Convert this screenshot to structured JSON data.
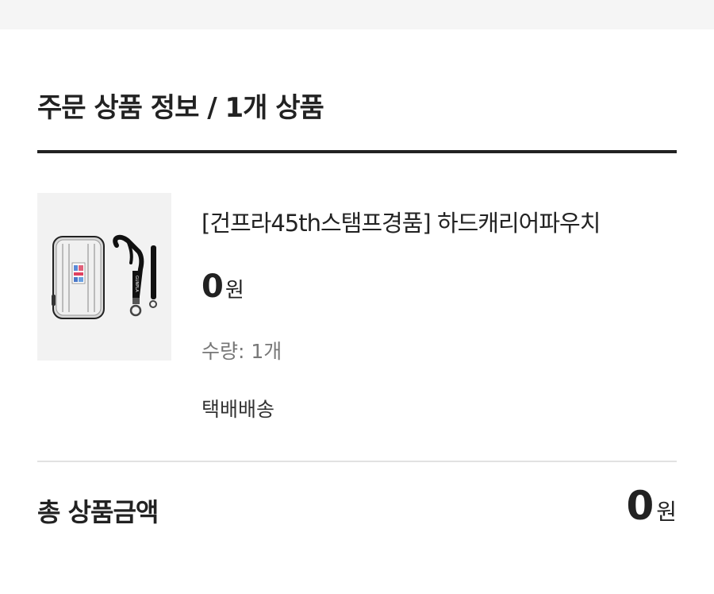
{
  "order_section": {
    "title": "주문 상품 정보 / 1개 상품"
  },
  "product": {
    "image_icon": "hard-carrier-pouch-image",
    "name": "[건프라45th스탬프경품] 하드캐리어파우치",
    "price_value": "0",
    "price_unit": "원",
    "quantity": "수량: 1개",
    "shipping": "택배배송"
  },
  "summary": {
    "total_label": "총 상품금액",
    "total_value": "0",
    "total_unit": "원"
  },
  "colors": {
    "text": "#222222",
    "muted_text": "#777777",
    "divider": "#e2e2e2",
    "thumb_bg": "#f2f2f2"
  }
}
